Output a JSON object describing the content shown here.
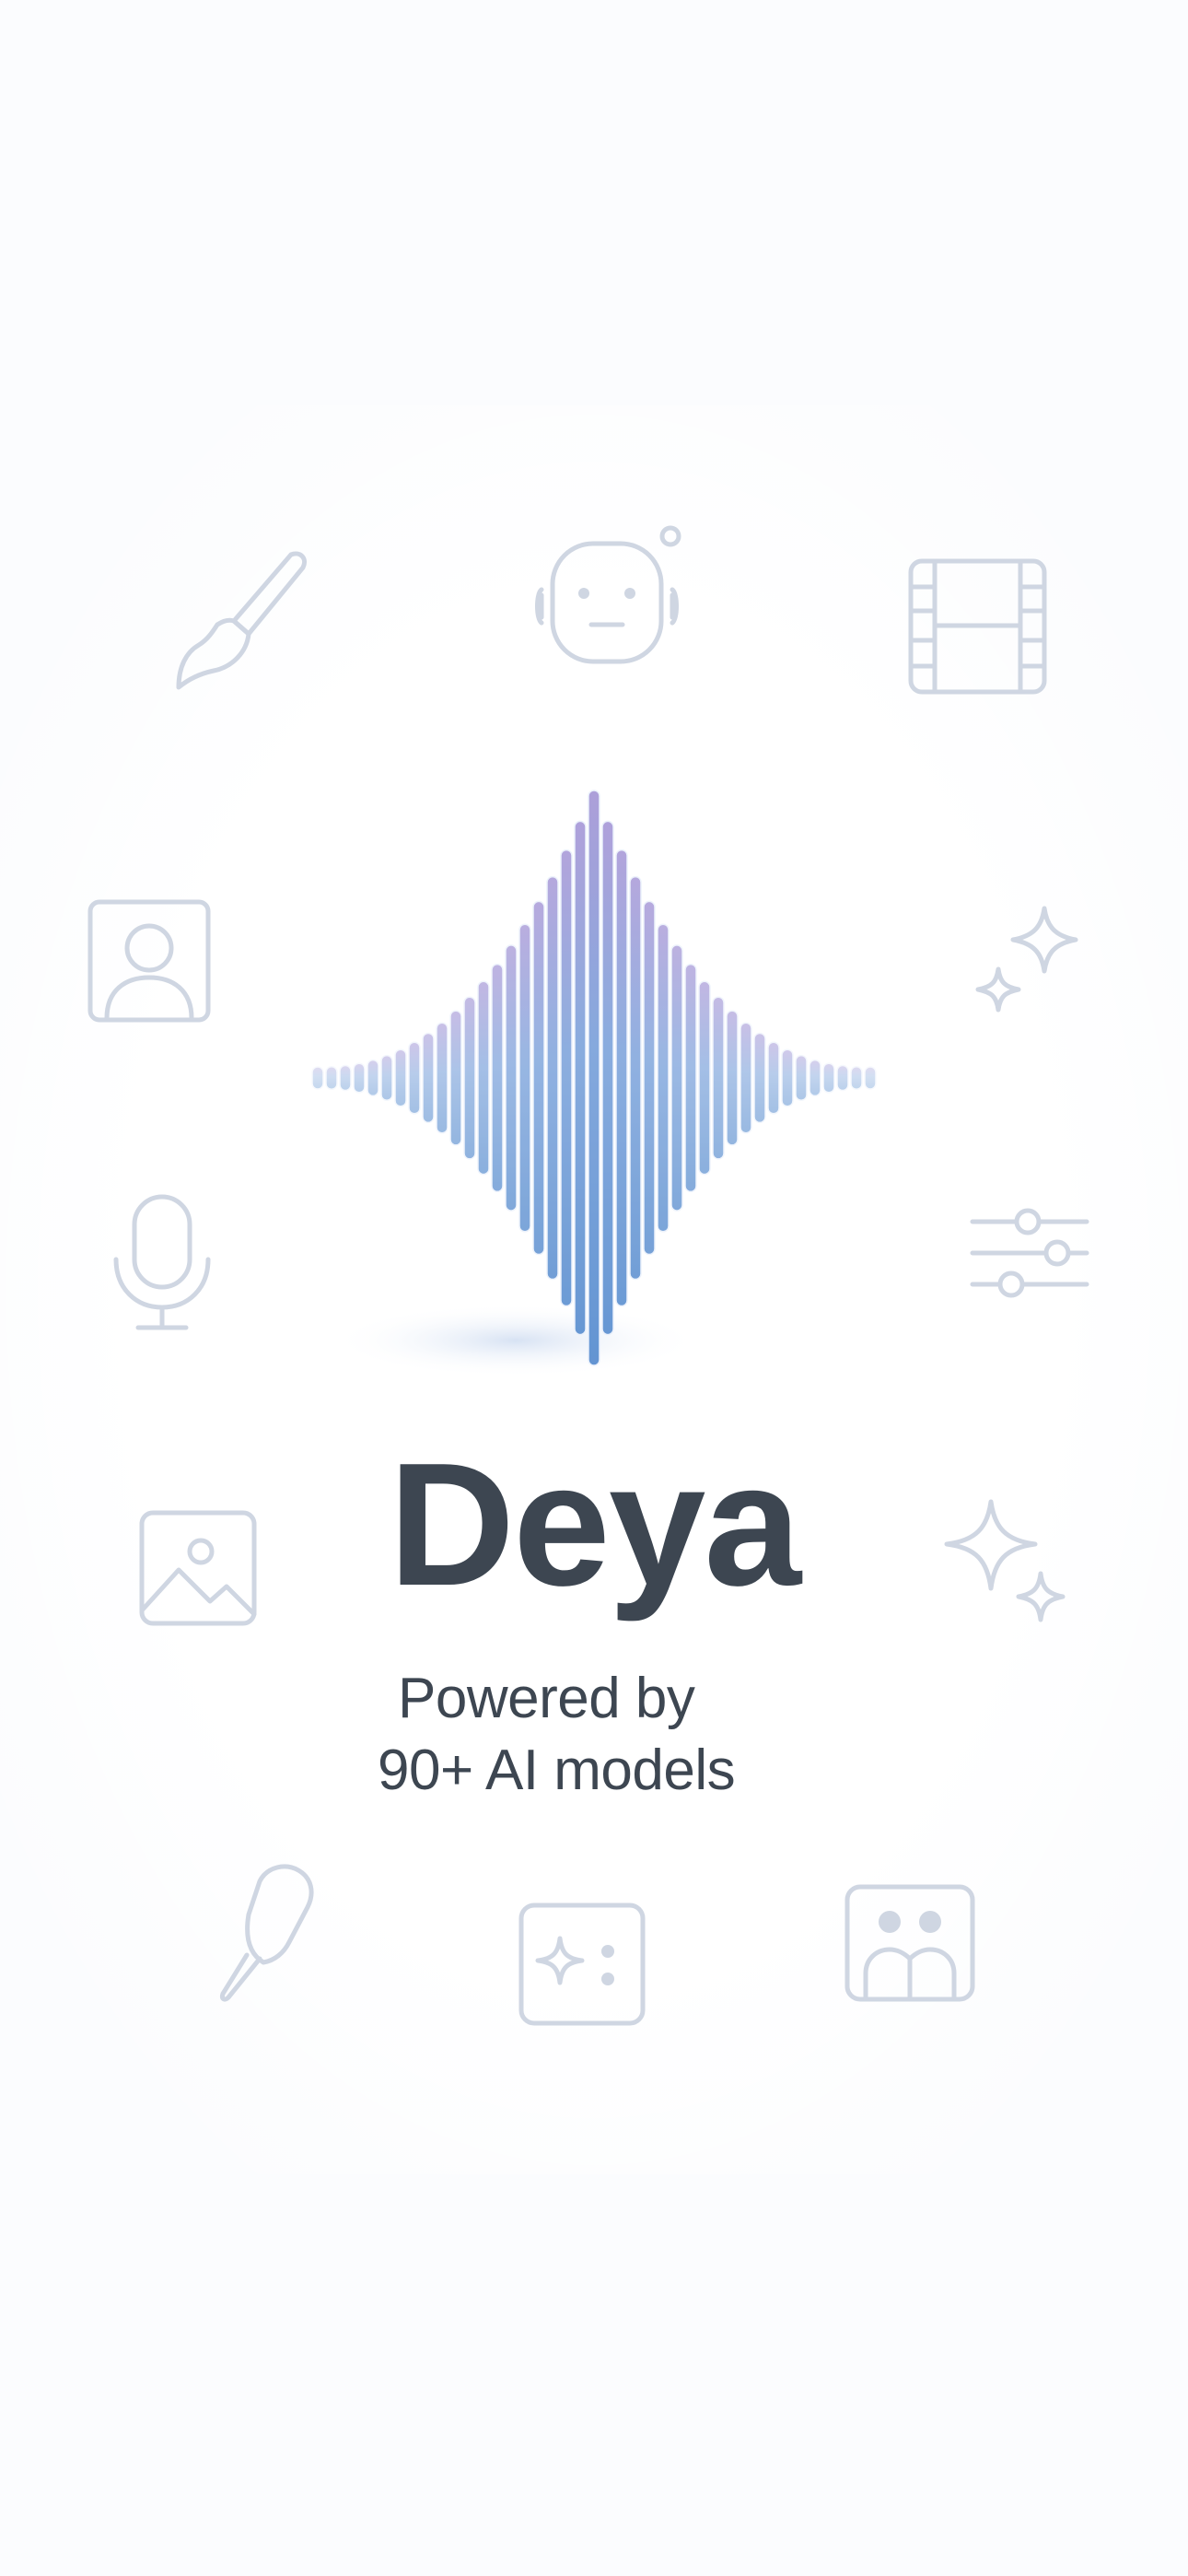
{
  "app": {
    "name": "Deya",
    "tagline_line1": "Powered by",
    "tagline_line2": "90+ AI models"
  },
  "icons": [
    "paintbrush-icon",
    "robot-icon",
    "film-strip-icon",
    "portrait-icon",
    "sparkles-icon",
    "microphone-icon",
    "sliders-icon",
    "image-icon",
    "sparkles-icon",
    "ice-cream-icon",
    "dice-sparkle-icon",
    "people-frame-icon"
  ],
  "colors": {
    "background": "#fbfcfe",
    "text": "#3d4651",
    "icon_stroke": "#cfd6e2",
    "logo_blue": "#5b8fd0",
    "logo_violet": "#a99ad8"
  }
}
